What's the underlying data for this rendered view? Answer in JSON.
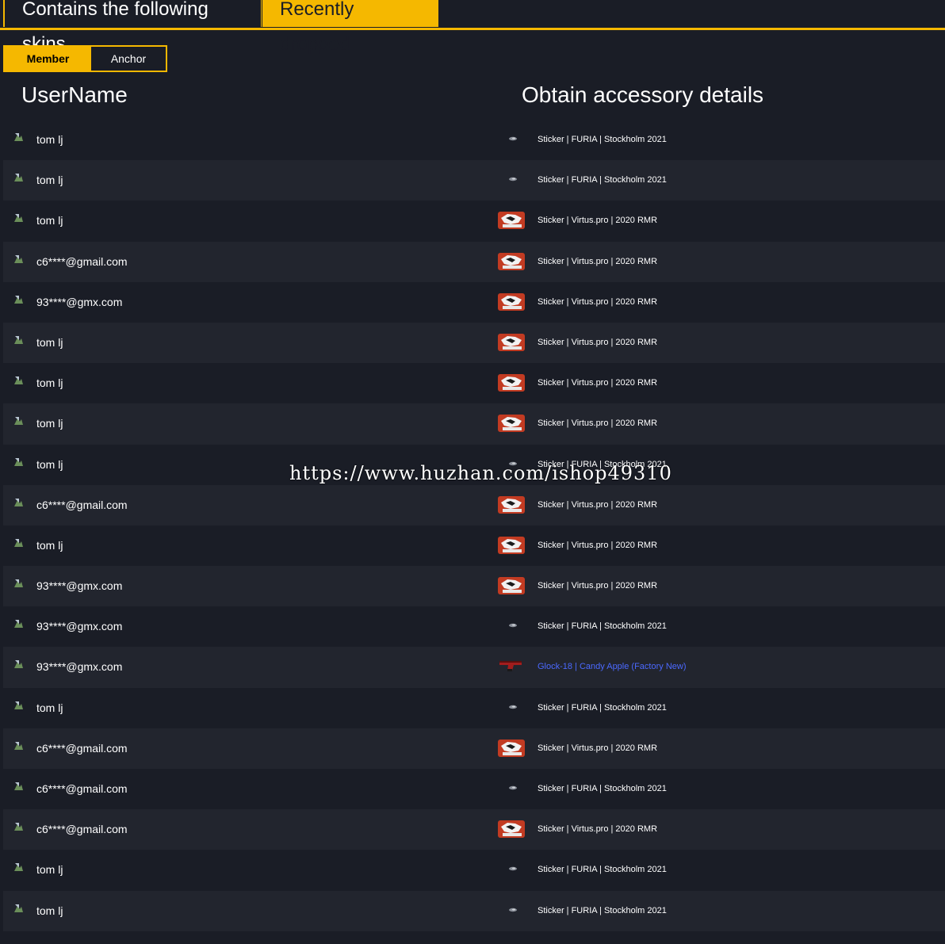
{
  "tabs": [
    {
      "label": "Contains the following skins"
    },
    {
      "label": "Recently dropped"
    }
  ],
  "toggle": {
    "member": "Member",
    "anchor": "Anchor"
  },
  "headers": {
    "username": "UserName",
    "details": "Obtain accessory details"
  },
  "rows": [
    {
      "user": "tom lj",
      "item": "Sticker | FURIA | Stockholm 2021",
      "icon": "small-sticker-icon"
    },
    {
      "user": "tom lj",
      "item": "Sticker | FURIA | Stockholm 2021",
      "icon": "small-sticker-icon"
    },
    {
      "user": "tom lj",
      "item": "Sticker | Virtus.pro | 2020 RMR",
      "icon": "virtus-pro-sticker-icon"
    },
    {
      "user": "c6****@gmail.com",
      "item": "Sticker | Virtus.pro | 2020 RMR",
      "icon": "virtus-pro-sticker-icon"
    },
    {
      "user": "93****@gmx.com",
      "item": "Sticker | Virtus.pro | 2020 RMR",
      "icon": "virtus-pro-sticker-icon"
    },
    {
      "user": "tom lj",
      "item": "Sticker | Virtus.pro | 2020 RMR",
      "icon": "virtus-pro-sticker-icon"
    },
    {
      "user": "tom lj",
      "item": "Sticker | Virtus.pro | 2020 RMR",
      "icon": "virtus-pro-sticker-icon"
    },
    {
      "user": "tom lj",
      "item": "Sticker | Virtus.pro | 2020 RMR",
      "icon": "virtus-pro-sticker-icon"
    },
    {
      "user": "tom lj",
      "item": "Sticker | FURIA | Stockholm 2021",
      "icon": "small-sticker-icon"
    },
    {
      "user": "c6****@gmail.com",
      "item": "Sticker | Virtus.pro | 2020 RMR",
      "icon": "virtus-pro-sticker-icon"
    },
    {
      "user": "tom lj",
      "item": "Sticker | Virtus.pro | 2020 RMR",
      "icon": "virtus-pro-sticker-icon"
    },
    {
      "user": "93****@gmx.com",
      "item": "Sticker | Virtus.pro | 2020 RMR",
      "icon": "virtus-pro-sticker-icon"
    },
    {
      "user": "93****@gmx.com",
      "item": "Sticker | FURIA | Stockholm 2021",
      "icon": "small-sticker-icon"
    },
    {
      "user": "93****@gmx.com",
      "item": "Glock-18 | Candy Apple (Factory New)",
      "icon": "glock-pistol-icon",
      "highlight": "#4b69ff"
    },
    {
      "user": "tom lj",
      "item": "Sticker | FURIA | Stockholm 2021",
      "icon": "small-sticker-icon"
    },
    {
      "user": "c6****@gmail.com",
      "item": "Sticker | Virtus.pro | 2020 RMR",
      "icon": "virtus-pro-sticker-icon"
    },
    {
      "user": "c6****@gmail.com",
      "item": "Sticker | FURIA | Stockholm 2021",
      "icon": "small-sticker-icon"
    },
    {
      "user": "c6****@gmail.com",
      "item": "Sticker | Virtus.pro | 2020 RMR",
      "icon": "virtus-pro-sticker-icon"
    },
    {
      "user": "tom lj",
      "item": "Sticker | FURIA | Stockholm 2021",
      "icon": "small-sticker-icon"
    },
    {
      "user": "tom lj",
      "item": "Sticker | FURIA | Stockholm 2021",
      "icon": "small-sticker-icon"
    }
  ],
  "watermark": "https://www.huzhan.com/ishop49310",
  "colors": {
    "accent": "#f5b800",
    "background": "#1a1d26",
    "row_alt": "#22252e",
    "rare_item": "#4b69ff"
  }
}
